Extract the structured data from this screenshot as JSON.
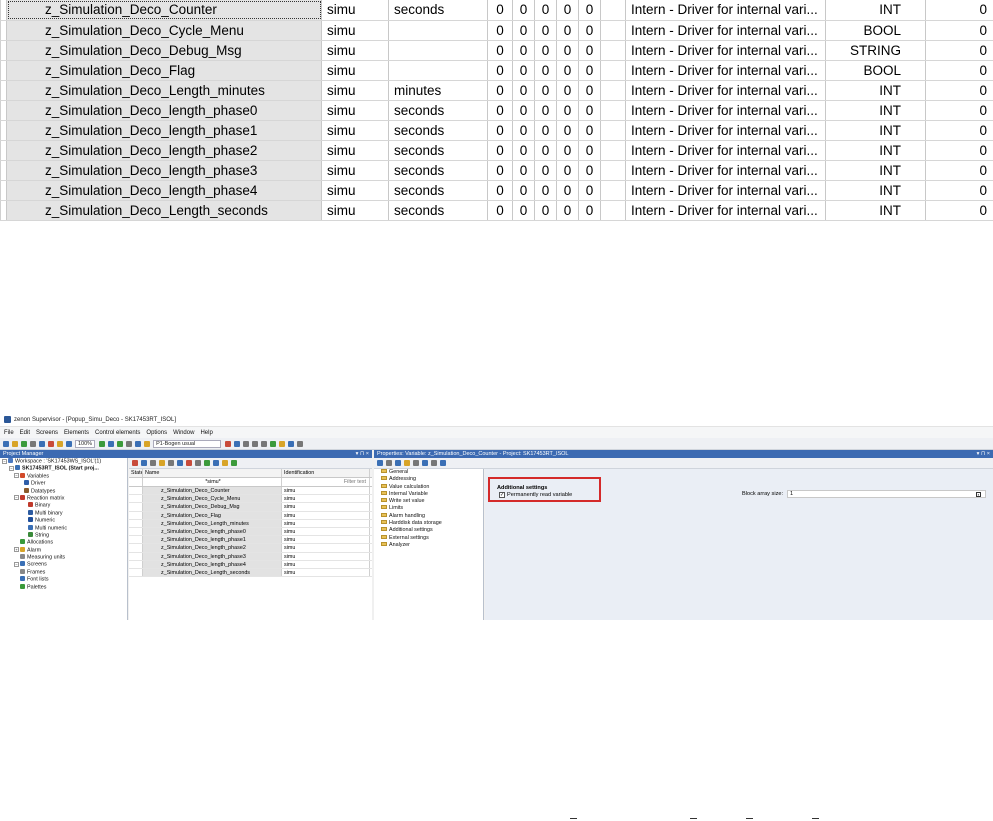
{
  "zoom_table": {
    "rows": [
      {
        "name": "z_Simulation_Deco_Counter",
        "driver": "simu",
        "unit": "seconds",
        "n1": "0",
        "n2": "0",
        "n3": "0",
        "n4": "0",
        "n5": "0",
        "desc": "Intern - Driver for internal vari...",
        "type": "INT",
        "last": "0"
      },
      {
        "name": "z_Simulation_Deco_Cycle_Menu",
        "driver": "simu",
        "unit": "",
        "n1": "0",
        "n2": "0",
        "n3": "0",
        "n4": "0",
        "n5": "0",
        "desc": "Intern - Driver for internal vari...",
        "type": "BOOL",
        "last": "0"
      },
      {
        "name": "z_Simulation_Deco_Debug_Msg",
        "driver": "simu",
        "unit": "",
        "n1": "0",
        "n2": "0",
        "n3": "0",
        "n4": "0",
        "n5": "0",
        "desc": "Intern - Driver for internal vari...",
        "type": "STRING",
        "last": "0"
      },
      {
        "name": "z_Simulation_Deco_Flag",
        "driver": "simu",
        "unit": "",
        "n1": "0",
        "n2": "0",
        "n3": "0",
        "n4": "0",
        "n5": "0",
        "desc": "Intern - Driver for internal vari...",
        "type": "BOOL",
        "last": "0"
      },
      {
        "name": "z_Simulation_Deco_Length_minutes",
        "driver": "simu",
        "unit": "minutes",
        "n1": "0",
        "n2": "0",
        "n3": "0",
        "n4": "0",
        "n5": "0",
        "desc": "Intern - Driver for internal vari...",
        "type": "INT",
        "last": "0"
      },
      {
        "name": "z_Simulation_Deco_length_phase0",
        "driver": "simu",
        "unit": "seconds",
        "n1": "0",
        "n2": "0",
        "n3": "0",
        "n4": "0",
        "n5": "0",
        "desc": "Intern - Driver for internal vari...",
        "type": "INT",
        "last": "0"
      },
      {
        "name": "z_Simulation_Deco_length_phase1",
        "driver": "simu",
        "unit": "seconds",
        "n1": "0",
        "n2": "0",
        "n3": "0",
        "n4": "0",
        "n5": "0",
        "desc": "Intern - Driver for internal vari...",
        "type": "INT",
        "last": "0"
      },
      {
        "name": "z_Simulation_Deco_length_phase2",
        "driver": "simu",
        "unit": "seconds",
        "n1": "0",
        "n2": "0",
        "n3": "0",
        "n4": "0",
        "n5": "0",
        "desc": "Intern - Driver for internal vari...",
        "type": "INT",
        "last": "0"
      },
      {
        "name": "z_Simulation_Deco_length_phase3",
        "driver": "simu",
        "unit": "seconds",
        "n1": "0",
        "n2": "0",
        "n3": "0",
        "n4": "0",
        "n5": "0",
        "desc": "Intern - Driver for internal vari...",
        "type": "INT",
        "last": "0"
      },
      {
        "name": "z_Simulation_Deco_length_phase4",
        "driver": "simu",
        "unit": "seconds",
        "n1": "0",
        "n2": "0",
        "n3": "0",
        "n4": "0",
        "n5": "0",
        "desc": "Intern - Driver for internal vari...",
        "type": "INT",
        "last": "0"
      },
      {
        "name": "z_Simulation_Deco_Length_seconds",
        "driver": "simu",
        "unit": "seconds",
        "n1": "0",
        "n2": "0",
        "n3": "0",
        "n4": "0",
        "n5": "0",
        "desc": "Intern - Driver for internal vari...",
        "type": "INT",
        "last": "0"
      }
    ]
  },
  "app": {
    "title": "zenon Supervisor - [Popup_Simu_Deco - SK17453RT_ISOL]",
    "menu": [
      "File",
      "Edit",
      "Screens",
      "Elements",
      "Control elements",
      "Options",
      "Window",
      "Help"
    ],
    "zoom": "100%",
    "profile": "P1-Bogen usual",
    "project_manager": {
      "title": "Project Manager",
      "tree": [
        {
          "label": "Workspace : 'SK17453WS_ISOL'(1)",
          "icon": "workspace-icon",
          "bold": false
        },
        {
          "label": "SK17453RT_ISOL (Start proj...",
          "icon": "project-icon",
          "bold": true
        },
        {
          "label": "Variables",
          "icon": "variables-icon",
          "bold": false
        },
        {
          "label": "Driver",
          "icon": "driver-icon",
          "bold": false
        },
        {
          "label": "Datatypes",
          "icon": "datatypes-icon",
          "bold": false
        },
        {
          "label": "Reaction matrix",
          "icon": "reaction-matrix-icon",
          "bold": false
        },
        {
          "label": "Binary",
          "icon": "binary-icon",
          "bold": false
        },
        {
          "label": "Multi binary",
          "icon": "multi-binary-icon",
          "bold": false
        },
        {
          "label": "Numeric",
          "icon": "numeric-icon",
          "bold": false
        },
        {
          "label": "Multi numeric",
          "icon": "multi-numeric-icon",
          "bold": false
        },
        {
          "label": "String",
          "icon": "string-icon",
          "bold": false
        },
        {
          "label": "Allocations",
          "icon": "allocations-icon",
          "bold": false
        },
        {
          "label": "Alarm",
          "icon": "alarm-icon",
          "bold": false
        },
        {
          "label": "Measuring units",
          "icon": "measuring-units-icon",
          "bold": false
        },
        {
          "label": "Screens",
          "icon": "screens-icon",
          "bold": false
        },
        {
          "label": "Frames",
          "icon": "frames-icon",
          "bold": false
        },
        {
          "label": "Font lists",
          "icon": "font-lists-icon",
          "bold": false
        },
        {
          "label": "Palettes",
          "icon": "palettes-icon",
          "bold": false
        }
      ],
      "headers": {
        "state": "State",
        "name": "Name",
        "id": "Identification"
      },
      "filter": {
        "name": "*simu*",
        "id": "Filter text"
      },
      "rows": [
        {
          "name": "z_Simulation_Deco_Counter",
          "id": "simu"
        },
        {
          "name": "z_Simulation_Deco_Cycle_Menu",
          "id": "simu"
        },
        {
          "name": "z_Simulation_Deco_Debug_Msg",
          "id": "simu"
        },
        {
          "name": "z_Simulation_Deco_Flag",
          "id": "simu"
        },
        {
          "name": "z_Simulation_Deco_Length_minutes",
          "id": "simu"
        },
        {
          "name": "z_Simulation_Deco_length_phase0",
          "id": "simu"
        },
        {
          "name": "z_Simulation_Deco_length_phase1",
          "id": "simu"
        },
        {
          "name": "z_Simulation_Deco_length_phase2",
          "id": "simu"
        },
        {
          "name": "z_Simulation_Deco_length_phase3",
          "id": "simu"
        },
        {
          "name": "z_Simulation_Deco_length_phase4",
          "id": "simu"
        },
        {
          "name": "z_Simulation_Deco_Length_seconds",
          "id": "simu"
        }
      ]
    },
    "properties": {
      "title": "Properties: Variable: z_Simulation_Deco_Counter - Project: SK17453RT_ISOL",
      "groups": [
        "General",
        "Addressing",
        "Value calculation",
        "Internal Variable",
        "Write set value",
        "Limits",
        "Alarm handling",
        "Harddisk data storage",
        "Additional settings",
        "External settings",
        "Analyzer"
      ],
      "section_title": "Additional settings",
      "permanent_label": "Permanently read variable",
      "permanent_checked": true,
      "block_label": "Block array size:",
      "block_value": "1"
    }
  }
}
